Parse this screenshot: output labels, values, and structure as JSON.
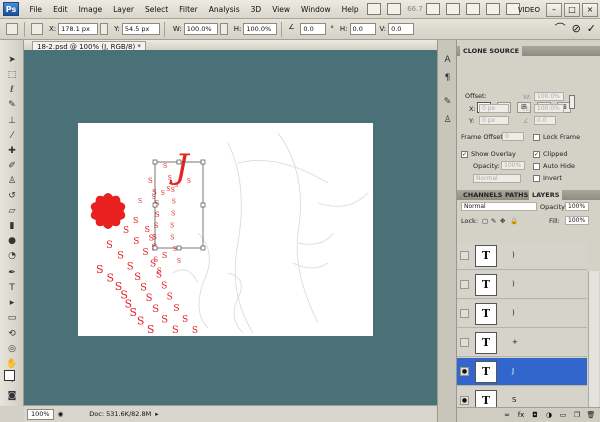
{
  "menubar": {
    "logo": "Ps",
    "items": [
      "File",
      "Edit",
      "Image",
      "Layer",
      "Select",
      "Filter",
      "Analysis",
      "3D",
      "View",
      "Window",
      "Help"
    ],
    "zoom": "66.7",
    "workspace": "VIDEO"
  },
  "options": {
    "x_label": "X:",
    "x_value": "178.1 px",
    "y_label": "Y:",
    "y_value": "54.5 px",
    "w_label": "W:",
    "w_value": "100.0%",
    "h_label": "H:",
    "h_value": "100.0%",
    "angle_value": "0.0",
    "skew_h_label": "H:",
    "skew_h_value": "0.0",
    "skew_v_label": "V:",
    "skew_v_value": "0.0",
    "unit_deg": "°"
  },
  "document": {
    "tab_title": "18-2.psd @ 100% (J, RGB/8) *",
    "letter": "J",
    "spiral_char": "S"
  },
  "status": {
    "zoom": "100%",
    "doc_size": "Doc: 531.6K/82.8M"
  },
  "clone_source": {
    "title": "CLONE SOURCE",
    "offset_label": "Offset:",
    "x_label": "X:",
    "x_value": "0 px",
    "y_label": "Y:",
    "y_value": "0 px",
    "w_label": "W:",
    "w_value": "100.0%",
    "h_label": "H:",
    "h_value": "100.0%",
    "angle_value": "0.0",
    "frame_offset_label": "Frame Offset:",
    "frame_offset_value": "0",
    "lock_frame_label": "Lock Frame",
    "show_overlay_label": "Show Overlay",
    "opacity_label": "Opacity:",
    "opacity_value": "100%",
    "mode_value": "Normal",
    "clipped_label": "Clipped",
    "auto_hide_label": "Auto Hide",
    "invert_label": "Invert"
  },
  "layers_panel": {
    "tabs": [
      "CHANNELS",
      "PATHS",
      "LAYERS"
    ],
    "blend_mode": "Normal",
    "opacity_label": "Opacity:",
    "opacity_value": "100%",
    "lock_label": "Lock:",
    "fill_label": "Fill:",
    "fill_value": "100%",
    "layers": [
      {
        "name": ")",
        "thumb": "T",
        "visible": false
      },
      {
        "name": ")",
        "thumb": "T",
        "visible": false
      },
      {
        "name": ")",
        "thumb": "T",
        "visible": false
      },
      {
        "name": "+",
        "thumb": "T",
        "visible": false
      },
      {
        "name": "J",
        "thumb": "T",
        "visible": true,
        "selected": true
      },
      {
        "name": "S",
        "thumb": "T",
        "visible": true
      }
    ]
  },
  "colors": {
    "canvas_bg": "#4b7178",
    "accent_red": "#e82020",
    "selection_blue": "#3366cc"
  }
}
